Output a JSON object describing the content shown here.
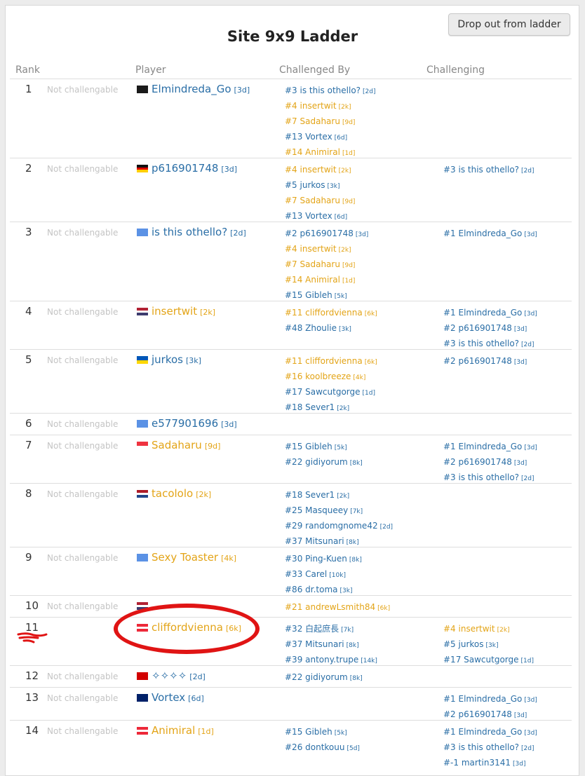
{
  "title": "Site 9x9 Ladder",
  "drop_button": "Drop out from ladder",
  "headers": {
    "rank": "Rank",
    "player": "Player",
    "challenged_by": "Challenged By",
    "challenging": "Challenging"
  },
  "colors": {
    "link": "#2a6ea6",
    "gold": "#e3a417",
    "annotation": "#e01414"
  },
  "rows": [
    {
      "rank": "1",
      "status": "Not challengable",
      "flag": "pirate",
      "name": "Elmindreda_Go",
      "rankLabel": "[3d]",
      "color": "blue",
      "by": [
        {
          "t": "#3 is this othello?",
          "r": "[2d]",
          "c": "blue"
        },
        {
          "t": "#4 insertwit",
          "r": "[2k]",
          "c": "gold"
        },
        {
          "t": "#7 Sadaharu",
          "r": "[9d]",
          "c": "gold"
        },
        {
          "t": "#13 Vortex",
          "r": "[6d]",
          "c": "blue"
        },
        {
          "t": "#14 Animiral",
          "r": "[1d]",
          "c": "gold"
        }
      ],
      "challenging": []
    },
    {
      "rank": "2",
      "status": "Not challengable",
      "flag": "de",
      "name": "p616901748",
      "rankLabel": "[3d]",
      "color": "blue",
      "by": [
        {
          "t": "#4 insertwit",
          "r": "[2k]",
          "c": "gold"
        },
        {
          "t": "#5 jurkos",
          "r": "[3k]",
          "c": "blue"
        },
        {
          "t": "#7 Sadaharu",
          "r": "[9d]",
          "c": "gold"
        },
        {
          "t": "#13 Vortex",
          "r": "[6d]",
          "c": "blue"
        }
      ],
      "challenging": [
        {
          "t": "#3 is this othello?",
          "r": "[2d]",
          "c": "blue"
        }
      ]
    },
    {
      "rank": "3",
      "status": "Not challengable",
      "flag": "un",
      "name": "is this othello?",
      "rankLabel": "[2d]",
      "color": "blue",
      "by": [
        {
          "t": "#2 p616901748",
          "r": "[3d]",
          "c": "blue"
        },
        {
          "t": "#4 insertwit",
          "r": "[2k]",
          "c": "gold"
        },
        {
          "t": "#7 Sadaharu",
          "r": "[9d]",
          "c": "gold"
        },
        {
          "t": "#14 Animiral",
          "r": "[1d]",
          "c": "gold"
        },
        {
          "t": "#15 Gibleh",
          "r": "[5k]",
          "c": "blue"
        }
      ],
      "challenging": [
        {
          "t": "#1 Elmindreda_Go",
          "r": "[3d]",
          "c": "blue"
        }
      ]
    },
    {
      "rank": "4",
      "status": "Not challengable",
      "flag": "us",
      "name": "insertwit",
      "rankLabel": "[2k]",
      "color": "gold",
      "by": [
        {
          "t": "#11 cliffordvienna",
          "r": "[6k]",
          "c": "gold"
        },
        {
          "t": "#48 Zhoulie",
          "r": "[3k]",
          "c": "blue"
        }
      ],
      "challenging": [
        {
          "t": "#1 Elmindreda_Go",
          "r": "[3d]",
          "c": "blue"
        },
        {
          "t": "#2 p616901748",
          "r": "[3d]",
          "c": "blue"
        },
        {
          "t": "#3 is this othello?",
          "r": "[2d]",
          "c": "blue"
        }
      ]
    },
    {
      "rank": "5",
      "status": "Not challengable",
      "flag": "ua",
      "name": "jurkos",
      "rankLabel": "[3k]",
      "color": "blue",
      "by": [
        {
          "t": "#11 cliffordvienna",
          "r": "[6k]",
          "c": "gold"
        },
        {
          "t": "#16 koolbreeze",
          "r": "[4k]",
          "c": "gold"
        },
        {
          "t": "#17 Sawcutgorge",
          "r": "[1d]",
          "c": "blue"
        },
        {
          "t": "#18 Sever1",
          "r": "[2k]",
          "c": "blue"
        }
      ],
      "challenging": [
        {
          "t": "#2 p616901748",
          "r": "[3d]",
          "c": "blue"
        }
      ]
    },
    {
      "rank": "6",
      "status": "Not challengable",
      "flag": "un",
      "name": "e577901696",
      "rankLabel": "[3d]",
      "color": "blue",
      "by": [],
      "challenging": []
    },
    {
      "rank": "7",
      "status": "Not challengable",
      "flag": "sg",
      "name": "Sadaharu",
      "rankLabel": "[9d]",
      "color": "gold",
      "by": [
        {
          "t": "#15 Gibleh",
          "r": "[5k]",
          "c": "blue"
        },
        {
          "t": "#22 gidiyorum",
          "r": "[8k]",
          "c": "blue"
        }
      ],
      "challenging": [
        {
          "t": "#1 Elmindreda_Go",
          "r": "[3d]",
          "c": "blue"
        },
        {
          "t": "#2 p616901748",
          "r": "[3d]",
          "c": "blue"
        },
        {
          "t": "#3 is this othello?",
          "r": "[2d]",
          "c": "blue"
        }
      ]
    },
    {
      "rank": "8",
      "status": "Not challengable",
      "flag": "nl",
      "name": "tacololo",
      "rankLabel": "[2k]",
      "color": "gold",
      "by": [
        {
          "t": "#18 Sever1",
          "r": "[2k]",
          "c": "blue"
        },
        {
          "t": "#25 Masqueey",
          "r": "[7k]",
          "c": "blue"
        },
        {
          "t": "#29 randomgnome42",
          "r": "[2d]",
          "c": "blue"
        },
        {
          "t": "#37 Mitsunari",
          "r": "[8k]",
          "c": "blue"
        }
      ],
      "challenging": []
    },
    {
      "rank": "9",
      "status": "Not challengable",
      "flag": "un",
      "name": "Sexy Toaster",
      "rankLabel": "[4k]",
      "color": "gold",
      "by": [
        {
          "t": "#30 Ping-Kuen",
          "r": "[8k]",
          "c": "blue"
        },
        {
          "t": "#33 Carel",
          "r": "[10k]",
          "c": "blue"
        },
        {
          "t": "#86 dr.toma",
          "r": "[3k]",
          "c": "blue"
        }
      ],
      "challenging": []
    },
    {
      "rank": "10",
      "status": "Not challengable",
      "flag": "us",
      "name": "",
      "rankLabel": "",
      "color": "gold",
      "by": [
        {
          "t": "#21 andrewLsmith84",
          "r": "[6k]",
          "c": "gold"
        }
      ],
      "challenging": []
    },
    {
      "rank": "11",
      "status": "",
      "flag": "at",
      "name": "cliffordvienna",
      "rankLabel": "[6k]",
      "color": "gold",
      "by": [
        {
          "t": "#32 白起庶長",
          "r": "[7k]",
          "c": "blue"
        },
        {
          "t": "#37 Mitsunari",
          "r": "[8k]",
          "c": "blue"
        },
        {
          "t": "#39 antony.trupe",
          "r": "[14k]",
          "c": "blue"
        }
      ],
      "challenging": [
        {
          "t": "#4 insertwit",
          "r": "[2k]",
          "c": "gold"
        },
        {
          "t": "#5 jurkos",
          "r": "[3k]",
          "c": "blue"
        },
        {
          "t": "#17 Sawcutgorge",
          "r": "[1d]",
          "c": "blue"
        }
      ]
    },
    {
      "rank": "12",
      "status": "Not challengable",
      "flag": "mk",
      "name": "✧✧✧✧",
      "rankLabel": "[2d]",
      "color": "blue",
      "by": [
        {
          "t": "#22 gidiyorum",
          "r": "[8k]",
          "c": "blue"
        }
      ],
      "challenging": []
    },
    {
      "rank": "13",
      "status": "Not challengable",
      "flag": "nz",
      "name": "Vortex",
      "rankLabel": "[6d]",
      "color": "blue",
      "by": [],
      "challenging": [
        {
          "t": "#1 Elmindreda_Go",
          "r": "[3d]",
          "c": "blue"
        },
        {
          "t": "#2 p616901748",
          "r": "[3d]",
          "c": "blue"
        }
      ]
    },
    {
      "rank": "14",
      "status": "Not challengable",
      "flag": "at",
      "name": "Animiral",
      "rankLabel": "[1d]",
      "color": "gold",
      "by": [
        {
          "t": "#15 Gibleh",
          "r": "[5k]",
          "c": "blue"
        },
        {
          "t": "#26 dontkouu",
          "r": "[5d]",
          "c": "blue"
        }
      ],
      "challenging": [
        {
          "t": "#1 Elmindreda_Go",
          "r": "[3d]",
          "c": "blue"
        },
        {
          "t": "#3 is this othello?",
          "r": "[2d]",
          "c": "blue"
        },
        {
          "t": "#-1 martin3141",
          "r": "[3d]",
          "c": "blue"
        }
      ]
    }
  ]
}
